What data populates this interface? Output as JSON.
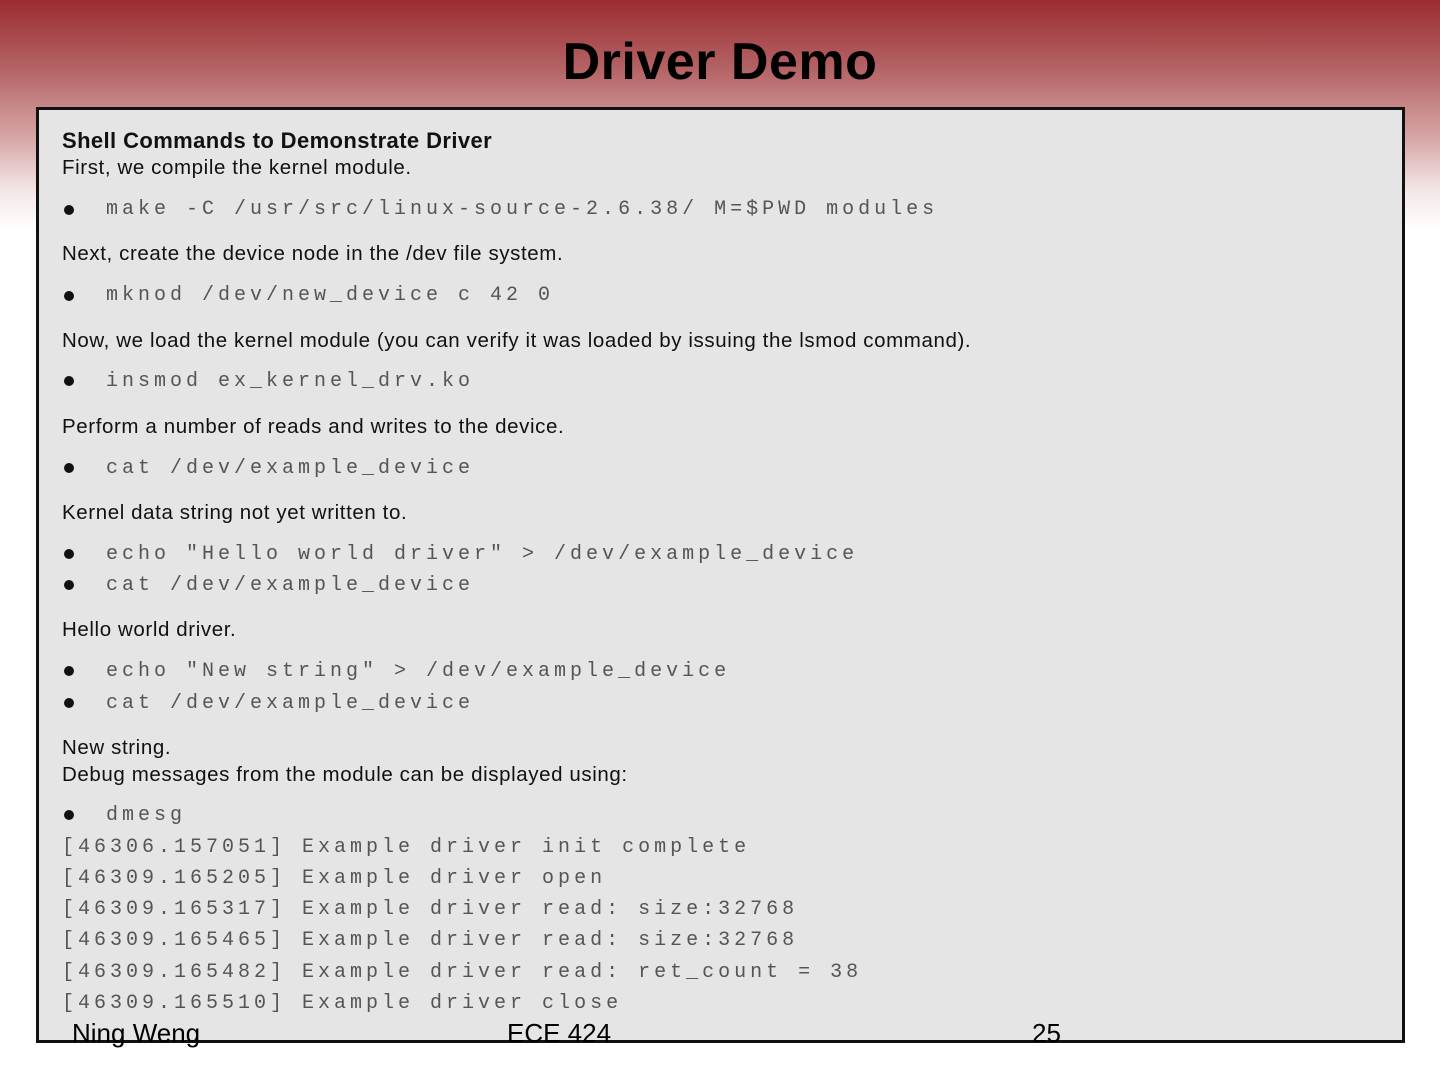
{
  "title": "Driver Demo",
  "heading": "Shell Commands to Demonstrate Driver",
  "lines": [
    "First, we compile the kernel module.",
    "make -C /usr/src/linux-source-2.6.38/ M=$PWD modules",
    "Next, create the device node in the /dev file system.",
    "mknod /dev/new_device c 42 0",
    "Now, we load the kernel module (you can verify it was loaded by issuing the lsmod command).",
    "insmod ex_kernel_drv.ko",
    "Perform a number of reads and writes to the device.",
    "cat /dev/example_device",
    "Kernel data string not yet written to.",
    "echo \"Hello world driver\" > /dev/example_device",
    "cat /dev/example_device",
    "Hello world driver.",
    "echo \"New string\" > /dev/example_device",
    "cat /dev/example_device",
    "New string.",
    "Debug messages from the module can be displayed using:",
    "dmesg",
    "[46306.157051] Example driver init complete",
    "[46309.165205] Example driver open",
    "[46309.165317] Example driver read: size:32768",
    "[46309.165465] Example driver read: size:32768",
    "[46309.165482] Example driver read: ret_count = 38",
    "[46309.165510] Example driver close"
  ],
  "footer": {
    "author": "Ning Weng",
    "course": "ECE 424",
    "page": "25"
  }
}
